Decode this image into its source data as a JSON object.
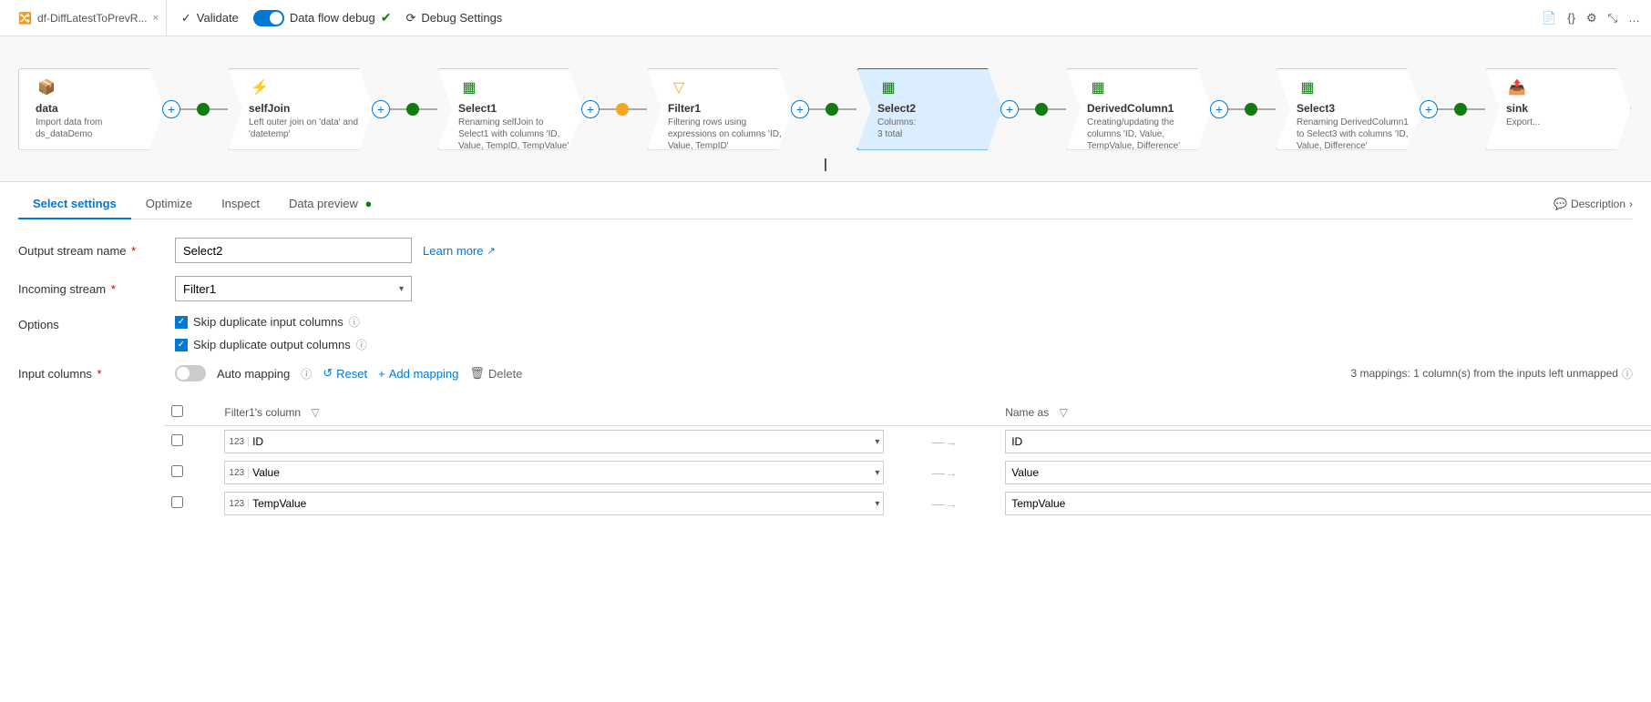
{
  "tab": {
    "title": "df-DiffLatestToPrevR...",
    "close": "×"
  },
  "toolbar": {
    "validate_label": "Validate",
    "debug_label": "Data flow debug",
    "debug_settings_label": "Debug Settings"
  },
  "pipeline": {
    "nodes": [
      {
        "id": "data",
        "title": "data",
        "desc": "Import data from ds_dataDemo",
        "icon": "📦",
        "selected": false,
        "first": true
      },
      {
        "id": "selfJoin",
        "title": "selfJoin",
        "desc": "Left outer join on 'data' and 'datetemp'",
        "icon": "⚡",
        "selected": false,
        "first": false
      },
      {
        "id": "Select1",
        "title": "Select1",
        "desc": "Renaming selfJoin to Select1 with columns 'ID, Value, TempID, TempValue'",
        "icon": "▦",
        "selected": false,
        "first": false
      },
      {
        "id": "Filter1",
        "title": "Filter1",
        "desc": "Filtering rows using expressions on columns 'ID, Value, TempID'",
        "icon": "▽",
        "selected": false,
        "first": false
      },
      {
        "id": "Select2",
        "title": "Select2",
        "subtitle": "Columns:",
        "count": "3 total",
        "icon": "▦",
        "selected": true,
        "first": false
      },
      {
        "id": "DerivedColumn1",
        "title": "DerivedColumn1",
        "desc": "Creating/updating the columns 'ID, Value, TempValue, Difference'",
        "icon": "▦",
        "selected": false,
        "first": false
      },
      {
        "id": "Select3",
        "title": "Select3",
        "desc": "Renaming DerivedColumn1 to Select3 with columns 'ID, Value, Difference'",
        "icon": "▦",
        "selected": false,
        "first": false
      }
    ]
  },
  "settings": {
    "tabs": [
      "Select settings",
      "Optimize",
      "Inspect",
      "Data preview"
    ],
    "active_tab": "Select settings",
    "description_label": "Description",
    "output_stream_label": "Output stream name",
    "output_stream_required": true,
    "output_stream_value": "Select2",
    "learn_more_label": "Learn more",
    "incoming_stream_label": "Incoming stream",
    "incoming_stream_required": true,
    "incoming_stream_value": "Filter1",
    "options_label": "Options",
    "skip_duplicate_input_label": "Skip duplicate input columns",
    "skip_duplicate_output_label": "Skip duplicate output columns",
    "input_columns_label": "Input columns",
    "auto_mapping_label": "Auto mapping",
    "reset_label": "Reset",
    "add_mapping_label": "Add mapping",
    "delete_label": "Delete",
    "mappings_info": "3 mappings: 1 column(s) from the inputs left unmapped",
    "table_headers": {
      "filter1_column": "Filter1's column",
      "name_as": "Name as"
    },
    "rows": [
      {
        "from_type": "123",
        "from_value": "ID",
        "to_value": "ID"
      },
      {
        "from_type": "123",
        "from_value": "Value",
        "to_value": "Value"
      },
      {
        "from_type": "123",
        "from_value": "TempValue",
        "to_value": "TempValue"
      }
    ]
  }
}
